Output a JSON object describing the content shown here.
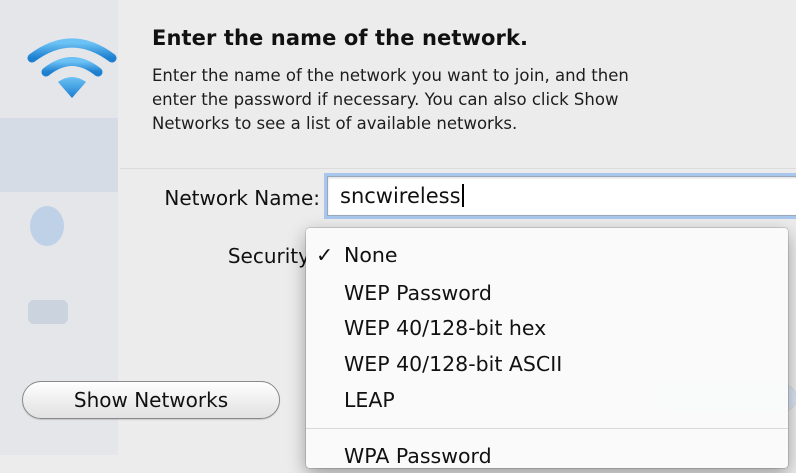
{
  "dialog": {
    "title": "Enter the name of the network.",
    "description": "Enter the name of the network you want to join, and then\nenter the password if necessary. You can also click Show\nNetworks to see a list of available networks.",
    "network_name_label": "Network Name:",
    "network_name_value": "sncwireless",
    "security_label": "Security",
    "show_networks_label": "Show Networks"
  },
  "security_menu": {
    "checkmark": "✓",
    "items": [
      {
        "label": "None",
        "checked": true
      },
      {
        "label": "WEP Password",
        "checked": false
      },
      {
        "label": "WEP 40/128-bit hex",
        "checked": false
      },
      {
        "label": "WEP 40/128-bit ASCII",
        "checked": false
      },
      {
        "label": "LEAP",
        "checked": false
      },
      {
        "label": "WPA Password",
        "checked": false
      }
    ]
  },
  "icons": {
    "wifi": "wifi-icon"
  },
  "colors": {
    "wifi_blue": "#3a9fe6",
    "focus_ring": "#a9c7ec"
  }
}
